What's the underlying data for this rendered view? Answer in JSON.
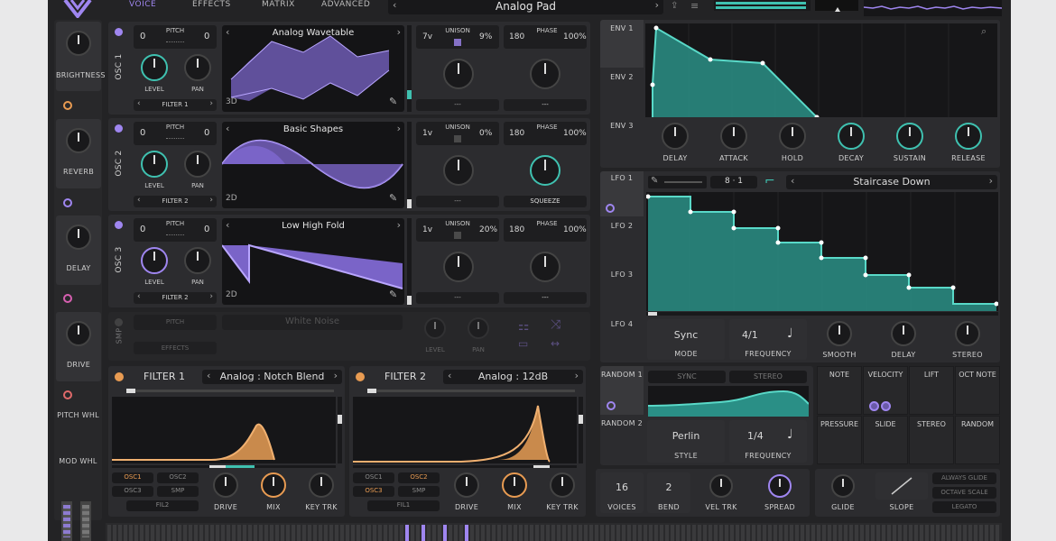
{
  "nav": {
    "tabs": [
      "VOICE",
      "EFFECTS",
      "MATRIX",
      "ADVANCED"
    ],
    "preset": "Analog Pad"
  },
  "sidebar": {
    "items": [
      "BRIGHTNESS",
      "REVERB",
      "DELAY",
      "DRIVE",
      "PITCH WHL",
      "MOD WHL"
    ]
  },
  "osc": [
    {
      "label": "OSC 1",
      "pitch_label": "PITCH",
      "pitch_l": "0",
      "pitch_r": "0",
      "wavetable": "Analog Wavetable",
      "dim": "3D",
      "unison_voices": "7v",
      "unison_label": "UNISON",
      "unison_detune": "9%",
      "phase_val": "180",
      "phase_label": "PHASE",
      "phase_pct": "100%",
      "level": "LEVEL",
      "pan": "PAN",
      "filter": "FILTER 1",
      "left_sel": "---",
      "right_sel": "---"
    },
    {
      "label": "OSC 2",
      "pitch_label": "PITCH",
      "pitch_l": "0",
      "pitch_r": "0",
      "wavetable": "Basic Shapes",
      "dim": "2D",
      "unison_voices": "1v",
      "unison_label": "UNISON",
      "unison_detune": "0%",
      "phase_val": "180",
      "phase_label": "PHASE",
      "phase_pct": "100%",
      "level": "LEVEL",
      "pan": "PAN",
      "filter": "FILTER 2",
      "left_sel": "---",
      "right_sel": "SQUEEZE"
    },
    {
      "label": "OSC 3",
      "pitch_label": "PITCH",
      "pitch_l": "0",
      "pitch_r": "0",
      "wavetable": "Low High Fold",
      "dim": "2D",
      "unison_voices": "1v",
      "unison_label": "UNISON",
      "unison_detune": "20%",
      "phase_val": "180",
      "phase_label": "PHASE",
      "phase_pct": "100%",
      "level": "LEVEL",
      "pan": "PAN",
      "filter": "FILTER 2",
      "left_sel": "---",
      "right_sel": "---"
    }
  ],
  "noise": {
    "label": "SMP",
    "pitch": "PITCH",
    "wave": "White Noise",
    "level": "LEVEL",
    "pan": "PAN",
    "effects": "EFFECTS"
  },
  "filters": [
    {
      "title": "FILTER 1",
      "model": "Analog",
      "type": "Notch Blend",
      "srcs": [
        "OSC1",
        "OSC2",
        "OSC3",
        "SMP",
        "FIL2"
      ],
      "drive": "DRIVE",
      "mix": "MIX",
      "keytrk": "KEY TRK"
    },
    {
      "title": "FILTER 2",
      "model": "Analog",
      "type": "12dB",
      "srcs": [
        "OSC1",
        "OSC2",
        "OSC3",
        "SMP",
        "FIL1"
      ],
      "drive": "DRIVE",
      "mix": "MIX",
      "keytrk": "KEY TRK"
    }
  ],
  "env": {
    "tabs": [
      "ENV 1",
      "ENV 2",
      "ENV 3"
    ],
    "knobs": [
      "DELAY",
      "ATTACK",
      "HOLD",
      "DECAY",
      "SUSTAIN",
      "RELEASE"
    ]
  },
  "lfo": {
    "tabs": [
      "LFO 1",
      "LFO 2",
      "LFO 3",
      "LFO 4"
    ],
    "grid": "8",
    "grid_b": "1",
    "preset": "Staircase Down",
    "mode_val": "Sync",
    "mode": "MODE",
    "freq_val": "4/1",
    "freq": "FREQUENCY",
    "knobs": [
      "SMOOTH",
      "DELAY",
      "STEREO"
    ]
  },
  "random": {
    "tabs": [
      "RANDOM 1",
      "RANDOM 2"
    ],
    "sync": "SYNC",
    "stereo": "STEREO",
    "style_val": "Perlin",
    "style": "STYLE",
    "freq_val": "1/4",
    "freq": "FREQUENCY"
  },
  "mods": [
    "NOTE",
    "VELOCITY",
    "LIFT",
    "OCT NOTE",
    "PRESSURE",
    "SLIDE",
    "STEREO",
    "RANDOM"
  ],
  "voice": {
    "voices_val": "16",
    "voices": "VOICES",
    "bend_val": "2",
    "bend": "BEND",
    "veltrk": "VEL TRK",
    "spread": "SPREAD",
    "glide": "GLIDE",
    "slope": "SLOPE",
    "opts": [
      "ALWAYS GLIDE",
      "OCTAVE SCALE",
      "LEGATO"
    ]
  },
  "colors": {
    "accent": "#9f86f0",
    "teal": "#3fc1b0",
    "orange": "#e89b52"
  }
}
